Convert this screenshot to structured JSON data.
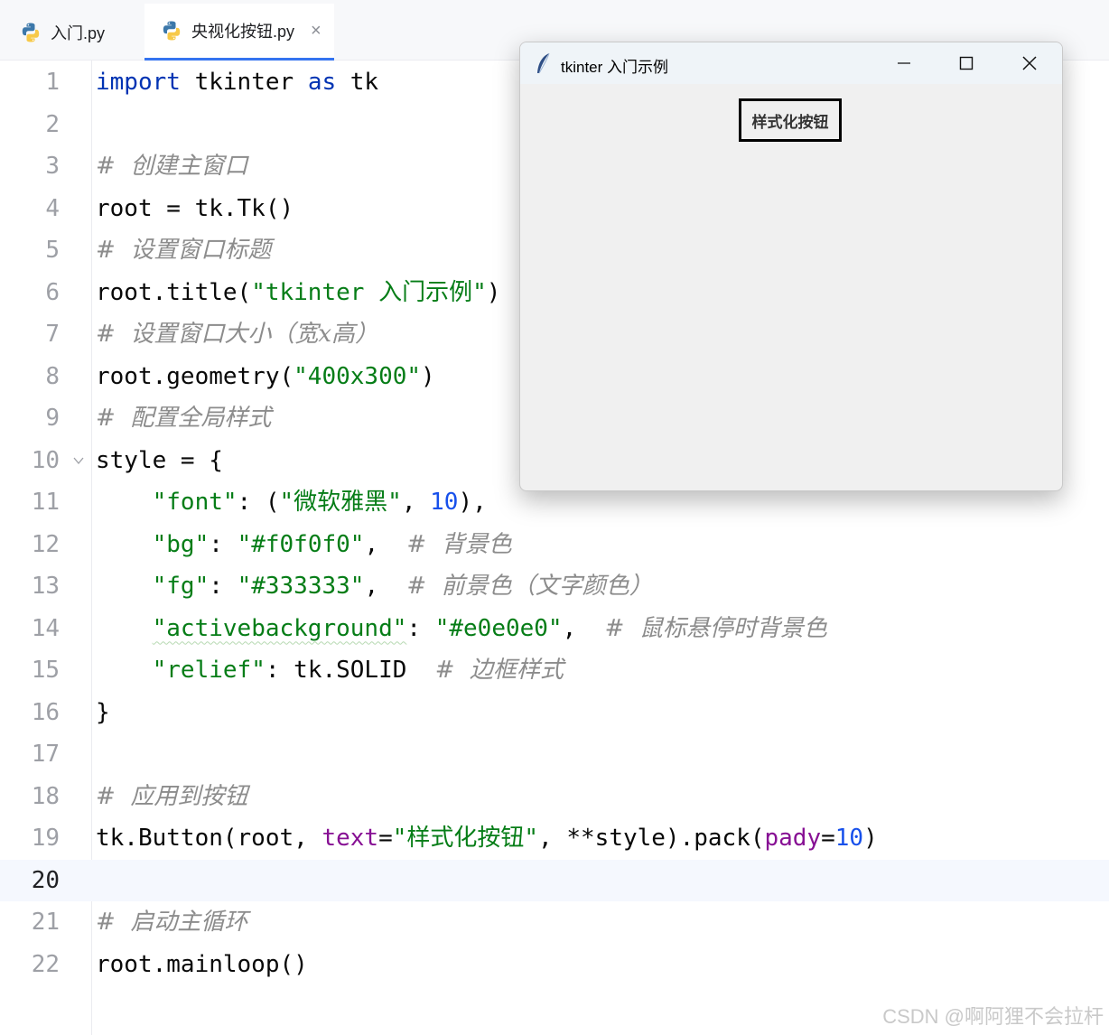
{
  "tabs": [
    {
      "label": "入门.py",
      "active": false
    },
    {
      "label": "央视化按钮.py",
      "active": true,
      "close": "×"
    }
  ],
  "editor": {
    "current_line": 20,
    "lines": [
      {
        "n": "1",
        "tokens": [
          [
            "kw",
            "import"
          ],
          [
            "p",
            " tkinter "
          ],
          [
            "kw",
            "as"
          ],
          [
            "p",
            " tk"
          ]
        ]
      },
      {
        "n": "2",
        "tokens": []
      },
      {
        "n": "3",
        "tokens": [
          [
            "cmt",
            "#  创建主窗口"
          ]
        ]
      },
      {
        "n": "4",
        "tokens": [
          [
            "p",
            "root = tk.Tk()"
          ]
        ]
      },
      {
        "n": "5",
        "tokens": [
          [
            "cmt",
            "#  设置窗口标题"
          ]
        ]
      },
      {
        "n": "6",
        "tokens": [
          [
            "p",
            "root.title("
          ],
          [
            "str",
            "\"tkinter 入门示例\""
          ],
          [
            "p",
            ")"
          ]
        ]
      },
      {
        "n": "7",
        "tokens": [
          [
            "cmt",
            "#  设置窗口大小（宽x高）"
          ]
        ]
      },
      {
        "n": "8",
        "tokens": [
          [
            "p",
            "root.geometry("
          ],
          [
            "str",
            "\"400x300\""
          ],
          [
            "p",
            ")"
          ]
        ]
      },
      {
        "n": "9",
        "tokens": [
          [
            "cmt",
            "#  配置全局样式"
          ]
        ]
      },
      {
        "n": "10",
        "tokens": [
          [
            "p",
            "style = {"
          ]
        ],
        "fold": true
      },
      {
        "n": "11",
        "tokens": [
          [
            "p",
            "    "
          ],
          [
            "str",
            "\"font\""
          ],
          [
            "p",
            ": ("
          ],
          [
            "str",
            "\"微软雅黑\""
          ],
          [
            "p",
            ", "
          ],
          [
            "num",
            "10"
          ],
          [
            "p",
            "),"
          ]
        ]
      },
      {
        "n": "12",
        "tokens": [
          [
            "p",
            "    "
          ],
          [
            "str",
            "\"bg\""
          ],
          [
            "p",
            ": "
          ],
          [
            "str",
            "\"#f0f0f0\""
          ],
          [
            "p",
            ",  "
          ],
          [
            "cmt",
            "#  背景色"
          ]
        ]
      },
      {
        "n": "13",
        "tokens": [
          [
            "p",
            "    "
          ],
          [
            "str",
            "\"fg\""
          ],
          [
            "p",
            ": "
          ],
          [
            "str",
            "\"#333333\""
          ],
          [
            "p",
            ",  "
          ],
          [
            "cmt",
            "#  前景色（文字颜色）"
          ]
        ]
      },
      {
        "n": "14",
        "tokens": [
          [
            "p",
            "    "
          ],
          [
            "str squig",
            "\"activebackground\""
          ],
          [
            "p",
            ": "
          ],
          [
            "str",
            "\"#e0e0e0\""
          ],
          [
            "p",
            ",  "
          ],
          [
            "cmt",
            "#  鼠标悬停时背景色"
          ]
        ]
      },
      {
        "n": "15",
        "tokens": [
          [
            "p",
            "    "
          ],
          [
            "str",
            "\"relief\""
          ],
          [
            "p",
            ": tk.SOLID  "
          ],
          [
            "cmt",
            "#  边框样式"
          ]
        ]
      },
      {
        "n": "16",
        "tokens": [
          [
            "p",
            "}"
          ]
        ]
      },
      {
        "n": "17",
        "tokens": []
      },
      {
        "n": "18",
        "tokens": [
          [
            "cmt",
            "#  应用到按钮"
          ]
        ]
      },
      {
        "n": "19",
        "tokens": [
          [
            "p",
            "tk.Button(root, "
          ],
          [
            "param",
            "text"
          ],
          [
            "p",
            "="
          ],
          [
            "str",
            "\"样式化按钮\""
          ],
          [
            "p",
            ", **style).pack("
          ],
          [
            "param",
            "pady"
          ],
          [
            "p",
            "="
          ],
          [
            "num",
            "10"
          ],
          [
            "p",
            ")"
          ]
        ]
      },
      {
        "n": "20",
        "tokens": []
      },
      {
        "n": "21",
        "tokens": [
          [
            "cmt",
            "#  启动主循环"
          ]
        ]
      },
      {
        "n": "22",
        "tokens": [
          [
            "p",
            "root.mainloop()"
          ]
        ]
      }
    ]
  },
  "tk_window": {
    "title": "tkinter 入门示例",
    "button_label": "样式化按钮",
    "icons": [
      "feather-icon",
      "minimize-icon",
      "maximize-icon",
      "close-icon"
    ]
  },
  "watermark": "CSDN @啊阿狸不会拉杆",
  "colors": {
    "keyword": "#0033b3",
    "string": "#067d17",
    "number": "#1750eb",
    "comment": "#8c8c8c",
    "param": "#871094",
    "accent": "#3574f0",
    "tk_bg": "#f0f0f0",
    "tk_fg": "#333333"
  }
}
